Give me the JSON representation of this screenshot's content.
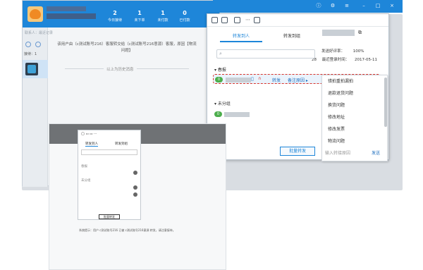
{
  "main_window": {
    "stats": [
      {
        "n": "2",
        "l": "今日接待"
      },
      {
        "n": "1",
        "l": "未下单"
      },
      {
        "n": "1",
        "l": "未付款"
      },
      {
        "n": "0",
        "l": "已付款"
      }
    ],
    "search_placeholder": "联系人：最近记录",
    "category_label": "接待：1",
    "chat_message": "该用户由（c测试账号216）客服转交给（c测试账号216意源）客服，原因【物流问题】",
    "history_label": "以上为历史消息"
  },
  "popup": {
    "tab_person": "转发到人",
    "tab_group": "转发到组",
    "group_spring": "春报",
    "group_unassigned": "未分组",
    "forward_label": "转发",
    "note_reason": "备注原因",
    "good_rate_label": "发送好评率：",
    "good_rate_value": "100%",
    "last_login_label": "最近登录时间：",
    "last_login_value": "2017-05-11",
    "num_28": "28",
    "batch_forward": "批量转发",
    "input_placeholder": "输入转接原因",
    "send": "发送",
    "reasons": [
      "错拍重拍漏拍",
      "退款退货问题",
      "换货问题",
      "修改地址",
      "修改发票",
      "物流问题"
    ]
  },
  "mini": {
    "tab_person": "转发到人",
    "tab_group": "转发到组",
    "group_spring": "春报",
    "group_unassigned": "未分组",
    "batch": "批量转发",
    "footer1": "系统提示：用户 c测试账号216 已被 c测试账号216意源 转发，请注意接待。"
  },
  "colors": {
    "accent": "#1e86d9",
    "online": "#4cae4c",
    "highlight_border": "#d9342b"
  }
}
